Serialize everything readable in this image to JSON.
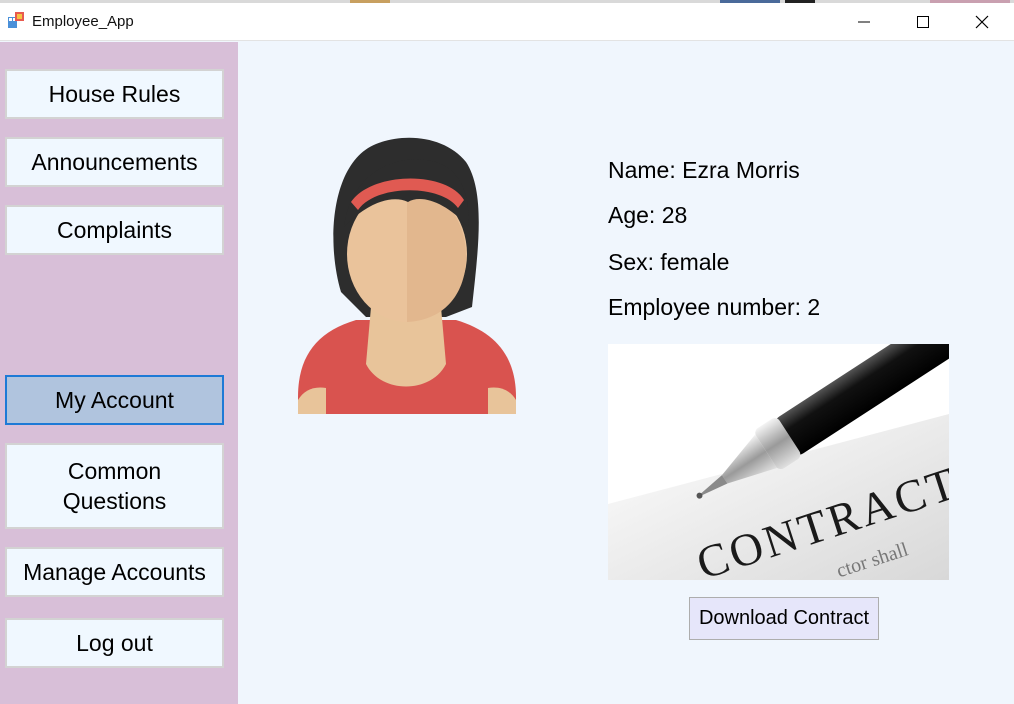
{
  "window": {
    "title": "Employee_App"
  },
  "sidebar": {
    "items": [
      {
        "label": "House Rules"
      },
      {
        "label": "Announcements"
      },
      {
        "label": "Complaints"
      },
      {
        "label": "My Account"
      },
      {
        "label": "Common\nQuestions"
      },
      {
        "label": "Manage Accounts"
      },
      {
        "label": "Log out"
      }
    ]
  },
  "profile": {
    "name_line": "Name: Ezra Morris",
    "age_line": "Age: 28",
    "sex_line": "Sex: female",
    "employee_number_line": "Employee number: 2",
    "contract_word": "CONTRACT",
    "contract_fine_text": "ctor shall",
    "download_label": "Download Contract"
  },
  "colors": {
    "sidebar_bg": "#d8bfd8",
    "main_bg": "#f0f6fd",
    "active_nav": "#b0c4de",
    "active_border": "#1e7ad6"
  }
}
